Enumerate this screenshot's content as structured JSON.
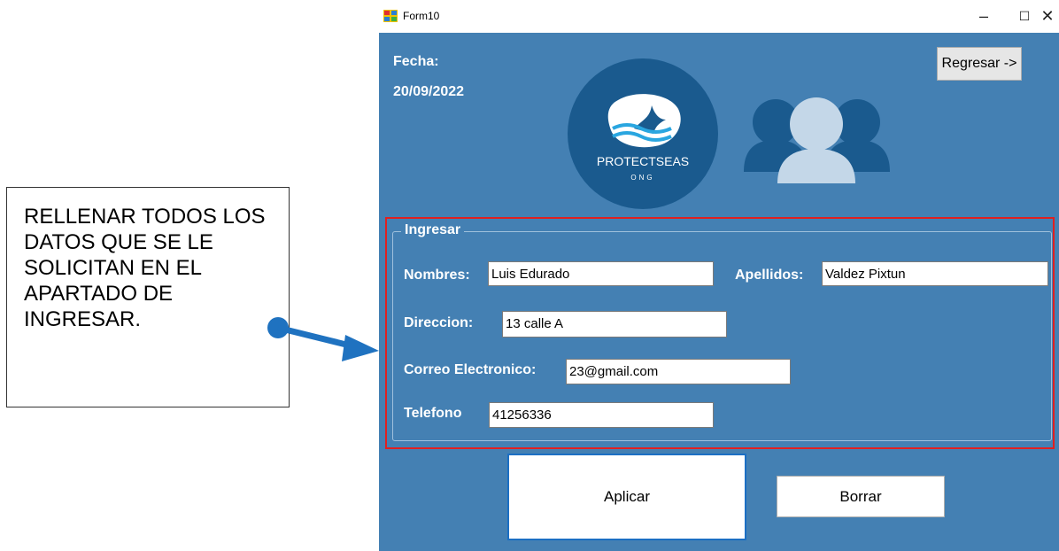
{
  "annotation": {
    "text": "RELLENAR TODOS LOS DATOS QUE SE LE SOLICITAN EN EL APARTADO DE INGRESAR."
  },
  "window": {
    "title": "Form10",
    "controls": {
      "minimize": "–",
      "maximize": "☐",
      "close": "✕"
    }
  },
  "header": {
    "date_label": "Fecha:",
    "date_value": "20/09/2022",
    "back_button": "Regresar ->"
  },
  "logo": {
    "brand": "PROTECTSEAS",
    "sub": "ONG"
  },
  "form": {
    "group_title": "Ingresar",
    "nombres_label": "Nombres:",
    "nombres_value": "Luis Edurado",
    "apellidos_label": "Apellidos:",
    "apellidos_value": "Valdez Pixtun",
    "direccion_label": "Direccion:",
    "direccion_value": "13 calle A",
    "correo_label": "Correo Electronico:",
    "correo_value": "23@gmail.com",
    "telefono_label": "Telefono",
    "telefono_value": "41256336"
  },
  "actions": {
    "apply": "Aplicar",
    "clear": "Borrar"
  },
  "colors": {
    "form_background": "#4480b3",
    "logo_circle": "#1a5a8e",
    "highlight_frame": "#e02020",
    "arrow": "#1f72c0"
  }
}
